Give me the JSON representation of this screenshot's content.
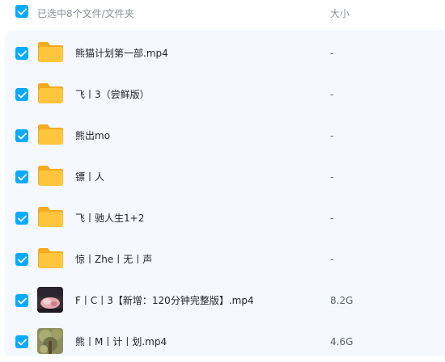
{
  "header": {
    "selection_label": "已选中8个文件/文件夹",
    "size_column": "大小"
  },
  "colors": {
    "accent": "#09aaff",
    "folder": "#ffc53d",
    "list_bg": "#f5f9ff"
  },
  "files": [
    {
      "name": "熊猫计划第一部.mp4",
      "size": "-",
      "icon": "folder-icon"
    },
    {
      "name": "飞丨3（尝鲜版）",
      "size": "-",
      "icon": "folder-icon"
    },
    {
      "name": "熊出mo",
      "size": "-",
      "icon": "folder-icon"
    },
    {
      "name": "镖丨人",
      "size": "-",
      "icon": "folder-icon"
    },
    {
      "name": "飞丨驰人生1+2",
      "size": "-",
      "icon": "folder-icon"
    },
    {
      "name": "惊丨Zhe丨无丨声",
      "size": "-",
      "icon": "folder-icon"
    },
    {
      "name": "F丨C丨3【新增：120分钟完整版】.mp4",
      "size": "8.2G",
      "icon": "video-thumbnail"
    },
    {
      "name": "熊丨M丨计丨划.mp4",
      "size": "4.6G",
      "icon": "video-thumbnail"
    }
  ]
}
